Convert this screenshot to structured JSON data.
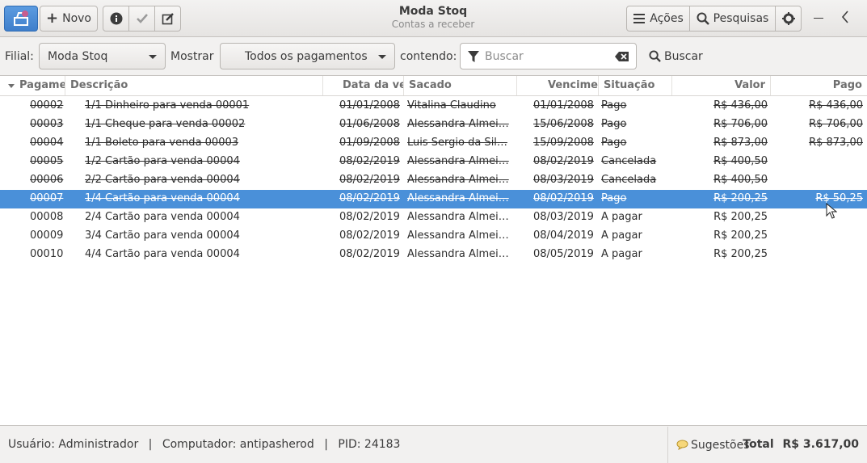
{
  "header": {
    "title": "Moda Stoq",
    "subtitle": "Contas a receber",
    "new_label": "Novo",
    "actions_label": "Ações",
    "searches_label": "Pesquisas",
    "icons": {
      "app": "register-icon",
      "new": "plus-icon",
      "info": "info-icon",
      "confirm": "check-icon",
      "edit": "edit-icon",
      "actions": "menu-icon",
      "searches": "search-icon",
      "settings": "gear-icon",
      "minimize": "minimize-icon",
      "back": "chevron-left-icon"
    }
  },
  "filter": {
    "branch_label": "Filial:",
    "branch_value": "Moda Stoq",
    "show_label": "Mostrar",
    "show_value": "Todos os pagamentos",
    "contains_label": "contendo:",
    "search_placeholder": "Buscar",
    "search_button": "Buscar"
  },
  "table": {
    "columns": [
      "Pagame",
      "Descrição",
      "Data da ve",
      "Sacado",
      "Venciment",
      "Situação",
      "Valor",
      "Pago"
    ],
    "rows": [
      {
        "id": "00002",
        "desc": "1/1 Dinheiro para venda 00001",
        "date": "01/01/2008",
        "payer": "Vitalina Claudino",
        "due": "01/01/2008",
        "status": "Pago",
        "value": "R$ 436,00",
        "paid": "R$ 436,00",
        "strike": true,
        "selected": false
      },
      {
        "id": "00003",
        "desc": "1/1 Cheque para venda 00002",
        "date": "01/06/2008",
        "payer": "Alessandra Almei…",
        "due": "15/06/2008",
        "status": "Pago",
        "value": "R$ 706,00",
        "paid": "R$ 706,00",
        "strike": true,
        "selected": false
      },
      {
        "id": "00004",
        "desc": "1/1 Boleto para venda 00003",
        "date": "01/09/2008",
        "payer": "Luis Sergio da Sil…",
        "due": "15/09/2008",
        "status": "Pago",
        "value": "R$ 873,00",
        "paid": "R$ 873,00",
        "strike": true,
        "selected": false
      },
      {
        "id": "00005",
        "desc": "1/2 Cartão para venda 00004",
        "date": "08/02/2019",
        "payer": "Alessandra Almei…",
        "due": "08/02/2019",
        "status": "Cancelada",
        "value": "R$ 400,50",
        "paid": "",
        "strike": true,
        "selected": false
      },
      {
        "id": "00006",
        "desc": "2/2 Cartão para venda 00004",
        "date": "08/02/2019",
        "payer": "Alessandra Almei…",
        "due": "08/03/2019",
        "status": "Cancelada",
        "value": "R$ 400,50",
        "paid": "",
        "strike": true,
        "selected": false
      },
      {
        "id": "00007",
        "desc": "1/4 Cartão para venda 00004",
        "date": "08/02/2019",
        "payer": "Alessandra Almei…",
        "due": "08/02/2019",
        "status": "Pago",
        "value": "R$ 200,25",
        "paid": "R$ 50,25",
        "strike": true,
        "selected": true
      },
      {
        "id": "00008",
        "desc": "2/4 Cartão para venda 00004",
        "date": "08/02/2019",
        "payer": "Alessandra Almei…",
        "due": "08/03/2019",
        "status": "A pagar",
        "value": "R$ 200,25",
        "paid": "",
        "strike": false,
        "selected": false
      },
      {
        "id": "00009",
        "desc": "3/4 Cartão para venda 00004",
        "date": "08/02/2019",
        "payer": "Alessandra Almei…",
        "due": "08/04/2019",
        "status": "A pagar",
        "value": "R$ 200,25",
        "paid": "",
        "strike": false,
        "selected": false
      },
      {
        "id": "00010",
        "desc": "4/4 Cartão para venda 00004",
        "date": "08/02/2019",
        "payer": "Alessandra Almei…",
        "due": "08/05/2019",
        "status": "A pagar",
        "value": "R$ 200,25",
        "paid": "",
        "strike": false,
        "selected": false
      }
    ]
  },
  "status": {
    "user": "Usuário: Administrador",
    "computer": "Computador: antipasherod",
    "pid": "PID: 24183",
    "separator": "|",
    "suggestions": "Sugestões",
    "total_label": "Total",
    "total_value": "R$ 3.617,00"
  },
  "colors": {
    "selection": "#4a90d9",
    "accent_app_button": "#4a8bd6"
  }
}
